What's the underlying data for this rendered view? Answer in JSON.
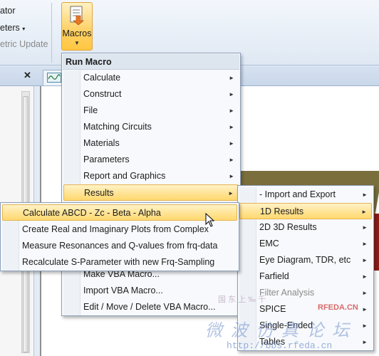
{
  "ribbon": {
    "item1": "ator",
    "item2": "eters",
    "item3": "etric Update",
    "macros_label": "Macros",
    "macros_dropdown": "▼"
  },
  "workspace": {
    "close_glyph": "✕"
  },
  "main_menu": {
    "header": "Run Macro",
    "items": [
      {
        "label": "Calculate",
        "has_submenu": true
      },
      {
        "label": "Construct",
        "has_submenu": true
      },
      {
        "label": "File",
        "has_submenu": true
      },
      {
        "label": "Matching Circuits",
        "has_submenu": true
      },
      {
        "label": "Materials",
        "has_submenu": true
      },
      {
        "label": "Parameters",
        "has_submenu": true
      },
      {
        "label": "Report and Graphics",
        "has_submenu": true
      },
      {
        "label": "Results",
        "has_submenu": true,
        "highlighted": true
      },
      {
        "label": "Make VBA Macro..."
      },
      {
        "label": "Import VBA Macro..."
      },
      {
        "label": "Edit / Move / Delete VBA Macro..."
      }
    ]
  },
  "results_menu": {
    "items": [
      {
        "label": "- Import and Export",
        "has_submenu": true
      },
      {
        "label": "1D Results",
        "has_submenu": true,
        "highlighted": true
      },
      {
        "label": "2D 3D Results",
        "has_submenu": true
      },
      {
        "label": "EMC",
        "has_submenu": true
      },
      {
        "label": "Eye Diagram, TDR, etc",
        "has_submenu": true
      },
      {
        "label": "Farfield",
        "has_submenu": true
      },
      {
        "label": "Filter Analysis",
        "has_submenu": true,
        "dim": true
      },
      {
        "label": "SPICE",
        "has_submenu": true
      },
      {
        "label": "Single-Ended",
        "has_submenu": true
      },
      {
        "label": "Tables",
        "has_submenu": true
      }
    ]
  },
  "oned_menu": {
    "items": [
      {
        "label": "Calculate ABCD - Zc - Beta - Alpha",
        "highlighted": true
      },
      {
        "label": "Create Real and Imaginary Plots from Complex"
      },
      {
        "label": "Measure Resonances and Q-values from frq-data"
      },
      {
        "label": "Recalculate S-Parameter with new Frq-Sampling"
      }
    ]
  },
  "watermark": {
    "line1": "国 东 上 ‰ 千",
    "brand": "RFEDA.CN",
    "chinese": "微 波 仿 真 论 坛",
    "url": "http://bbs.rfeda.cn"
  },
  "colors": {
    "highlight_top": "#fff2c6",
    "highlight_bottom": "#ffd86e",
    "menu_bg": "#f7f9fc",
    "ribbon_bg": "#e4ebf4"
  }
}
